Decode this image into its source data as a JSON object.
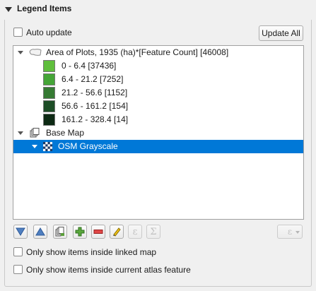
{
  "header": {
    "title": "Legend Items"
  },
  "auto_update": {
    "label": "Auto update",
    "checked": false
  },
  "update_all_button": {
    "label": "Update All"
  },
  "tree": {
    "layer_area": {
      "label": "Area of Plots, 1935 (ha)*[Feature Count] [46008]",
      "icon": "polygon-layer-icon",
      "classes": [
        {
          "label": "0 - 6.4 [37436]",
          "color": "#5fbe3c"
        },
        {
          "label": "6.4 - 21.2 [7252]",
          "color": "#45a537"
        },
        {
          "label": "21.2 - 56.6 [1152]",
          "color": "#357a33"
        },
        {
          "label": "56.6 - 161.2 [154]",
          "color": "#1d4d26"
        },
        {
          "label": "161.2 - 328.4 [14]",
          "color": "#0d2a14"
        }
      ]
    },
    "group_base": {
      "label": "Base Map",
      "icon": "group-icon"
    },
    "layer_osm": {
      "label": "OSM Grayscale",
      "icon": "raster-layer-icon",
      "selected": true
    }
  },
  "toolbar": {
    "buttons": [
      "move-down-icon",
      "move-up-icon",
      "add-group-icon",
      "add-item-icon",
      "remove-item-icon",
      "edit-item-icon",
      "expression-icon",
      "sum-icon"
    ],
    "expression_symbol": "ε",
    "sum_symbol": "Σ"
  },
  "options": {
    "linked_map": {
      "label": "Only show items inside linked map",
      "checked": false
    },
    "atlas_feature": {
      "label": "Only show items inside current atlas feature",
      "checked": false
    }
  }
}
